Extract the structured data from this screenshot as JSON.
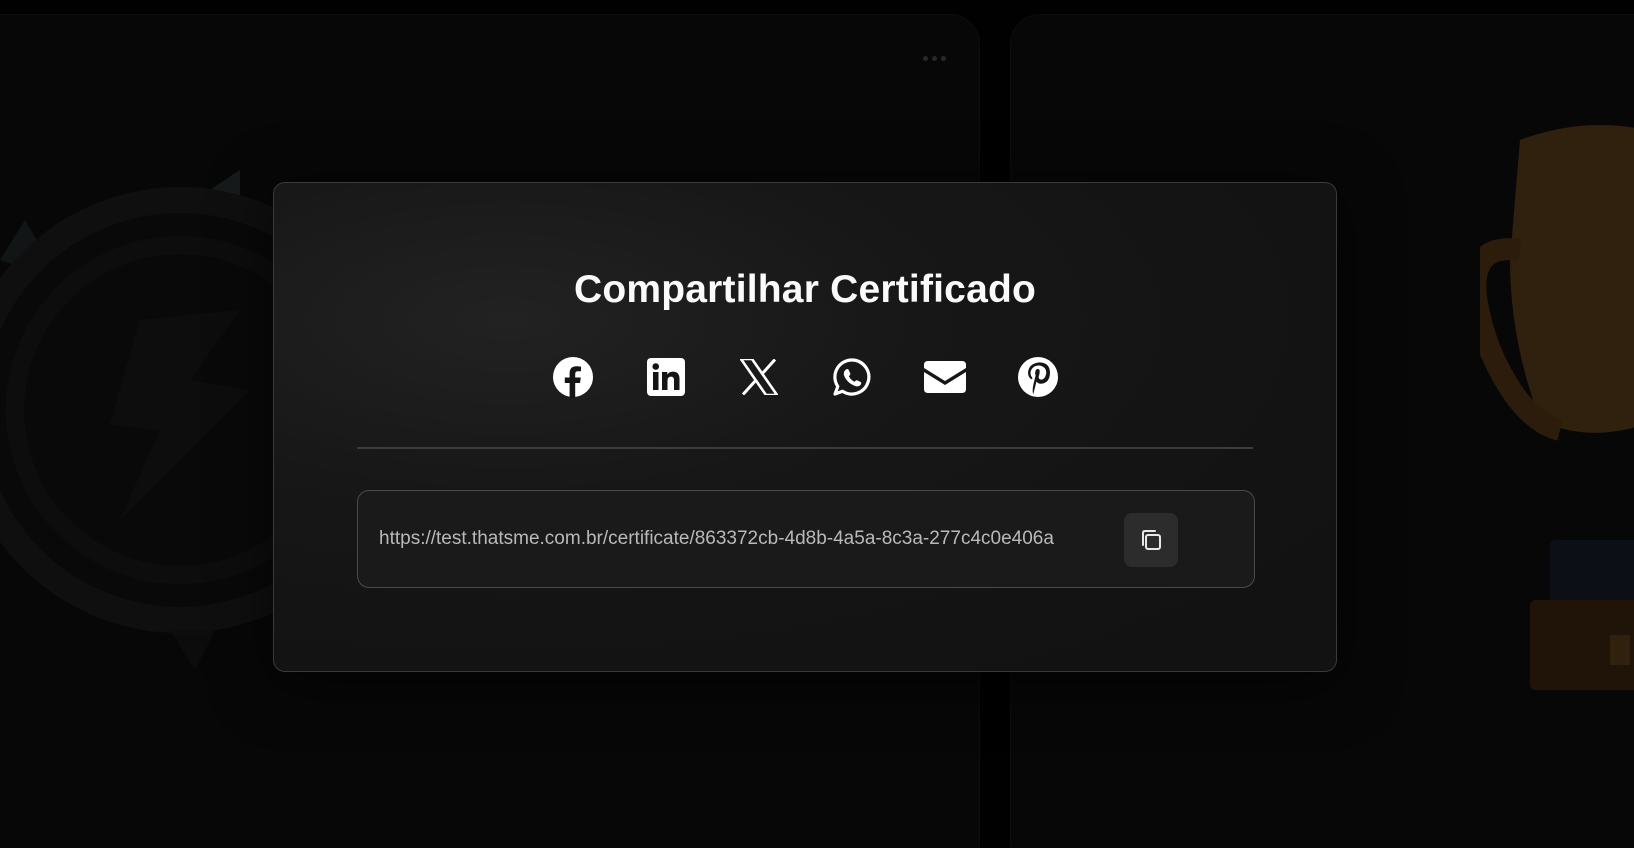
{
  "modal": {
    "title": "Compartilhar Certificado",
    "share_options": [
      {
        "name": "Facebook",
        "icon": "facebook-icon"
      },
      {
        "name": "LinkedIn",
        "icon": "linkedin-icon"
      },
      {
        "name": "X",
        "icon": "x-icon"
      },
      {
        "name": "WhatsApp",
        "icon": "whatsapp-icon"
      },
      {
        "name": "Email",
        "icon": "email-icon"
      },
      {
        "name": "Pinterest",
        "icon": "pinterest-icon"
      }
    ],
    "certificate_url": "https://test.thatsme.com.br/certificate/863372cb-4d8b-4a5a-8c3a-277c4c0e406a",
    "copy_icon": "copy-icon"
  },
  "background": {
    "more_icon": "more-horizontal-icon",
    "emblem_icon": "laurel-emblem-icon",
    "trophy_icon": "trophy-icon"
  },
  "colors": {
    "modal_bg": "#141414",
    "modal_border": "#3a3a3a",
    "text_primary": "#fafafa",
    "text_secondary": "#b9b9b9",
    "trophy": "#8a5a22"
  }
}
